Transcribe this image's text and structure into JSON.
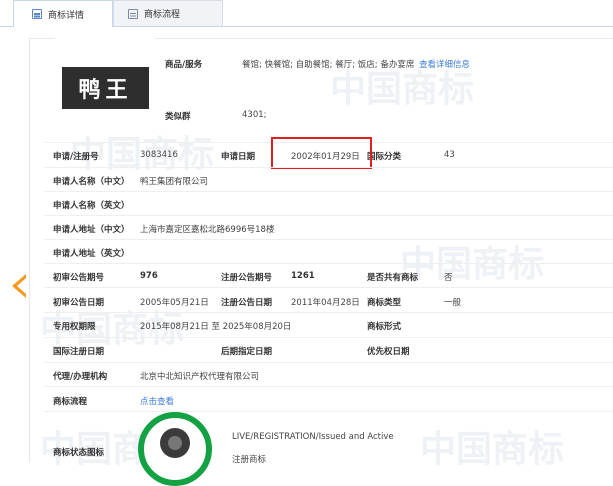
{
  "tabs": [
    {
      "label": "商标详情",
      "active": true
    },
    {
      "label": "商标流程",
      "active": false
    }
  ],
  "watermark": "中国商标",
  "logo": {
    "text": "鸭王"
  },
  "goods": {
    "label": "商品/服务",
    "value": "餐馆; 快餐馆; 自助餐馆; 餐厅; 饭店; 备办宴席",
    "link": "查看详细信息"
  },
  "similar_group": {
    "label": "类似群",
    "value": "4301;"
  },
  "application": {
    "reg_no_label": "申请/注册号",
    "reg_no": "3083416",
    "date_label": "申请日期",
    "date": "2002年01月29日",
    "intl_class_label": "国际分类",
    "intl_class": "43"
  },
  "applicant_cn": {
    "label": "申请人名称（中文）",
    "value": "鸭王集团有限公司"
  },
  "applicant_en": {
    "label": "申请人名称（英文）",
    "value": ""
  },
  "address_cn": {
    "label": "申请人地址（中文）",
    "value": "上海市嘉定区嘉松北路6996号18楼"
  },
  "address_en": {
    "label": "申请人地址（英文）",
    "value": ""
  },
  "prelim": {
    "issue_label": "初审公告期号",
    "issue": "976",
    "reg_issue_label": "注册公告期号",
    "reg_issue": "1261",
    "shared_label": "是否共有商标",
    "shared": "否"
  },
  "dates": {
    "prelim_date_label": "初审公告日期",
    "prelim_date": "2005年05月21日",
    "reg_date_label": "注册公告日期",
    "reg_date": "2011年04月28日",
    "type_label": "商标类型",
    "type": "一般"
  },
  "exclusive": {
    "label": "专用权期限",
    "value": "2015年08月21日 至 2025年08月20日",
    "form_label": "商标形式",
    "form": ""
  },
  "intl_reg": {
    "label": "国际注册日期",
    "value": "",
    "later_label": "后期指定日期",
    "later": "",
    "priority_label": "优先权日期",
    "priority": ""
  },
  "agent": {
    "label": "代理/办理机构",
    "value": "北京中北知识产权代理有限公司"
  },
  "process": {
    "label": "商标流程",
    "link": "点击查看"
  },
  "status": {
    "label": "商标状态图标",
    "line1": "LIVE/REGISTRATION/Issued and Active",
    "line2": "注册商标"
  },
  "colors": {
    "accent": "#3d7bd9",
    "highlight": "#e02020",
    "arrow": "#f39a1e",
    "badge": "#13a143"
  },
  "icons": [
    "document-icon",
    "flow-icon",
    "arrow-left-icon",
    "status-seal-icon"
  ]
}
